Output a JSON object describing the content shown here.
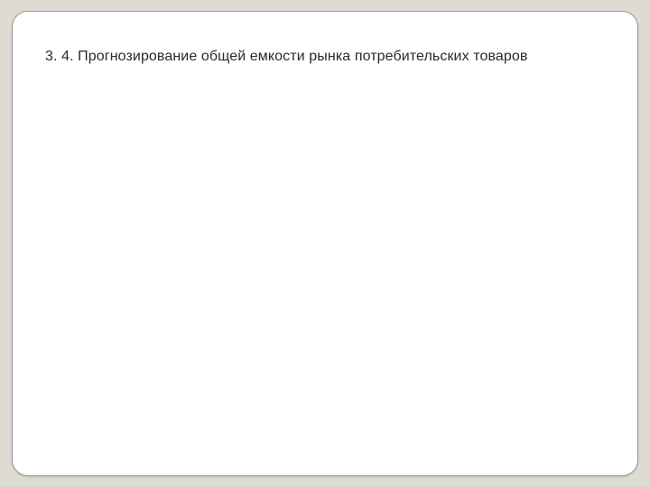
{
  "slide": {
    "title": "3. 4. Прогнозирование общей емкости рынка потребительских товаров"
  }
}
